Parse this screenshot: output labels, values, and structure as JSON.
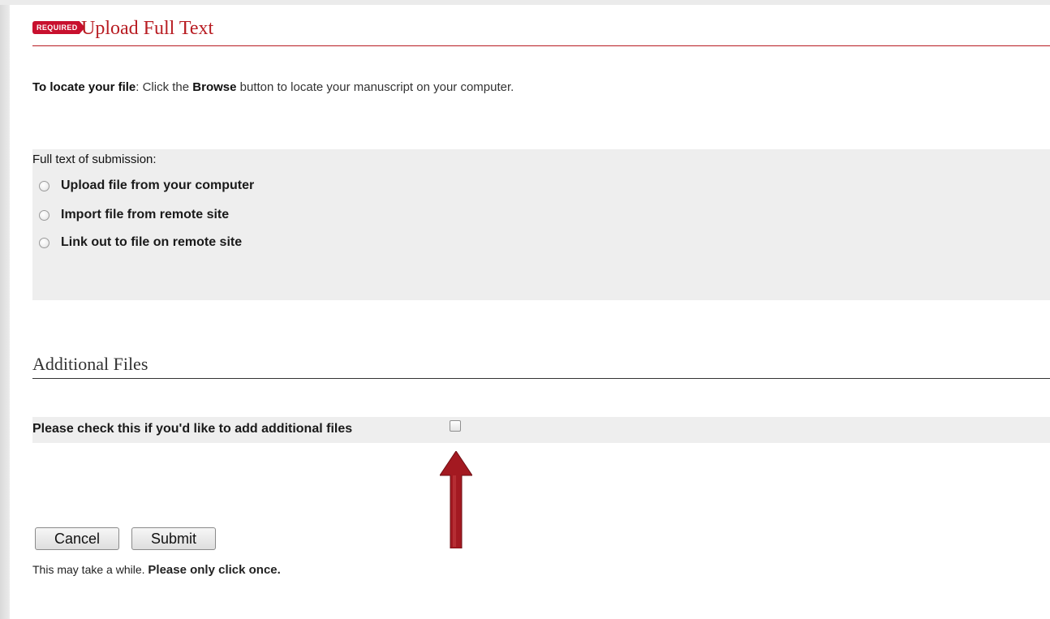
{
  "header": {
    "badge": "REQUIRED",
    "title": "Upload Full Text"
  },
  "instructions": {
    "lead": "To locate your file",
    "text_1": ": Click the ",
    "browse": "Browse",
    "text_2": " button to locate your manuscript on your computer."
  },
  "full_text": {
    "label": "Full text of submission:",
    "options": [
      {
        "label": "Upload file from your computer",
        "selected": false
      },
      {
        "label": "Import file from remote site",
        "selected": false
      },
      {
        "label": "Link out to file on remote site",
        "selected": false
      }
    ]
  },
  "additional_files": {
    "title": "Additional Files",
    "check_label": "Please check this if you'd like to add additional files",
    "checked": false
  },
  "buttons": {
    "cancel": "Cancel",
    "submit": "Submit"
  },
  "note": {
    "part1": "This may take a while. ",
    "part2": "Please only click once."
  },
  "colors": {
    "accent_red": "#b81c22",
    "badge_red": "#c8102e",
    "arrow_red": "#a31921",
    "panel_gray": "#eeeeee"
  },
  "icons": {
    "arrow": "up-arrow-icon"
  }
}
